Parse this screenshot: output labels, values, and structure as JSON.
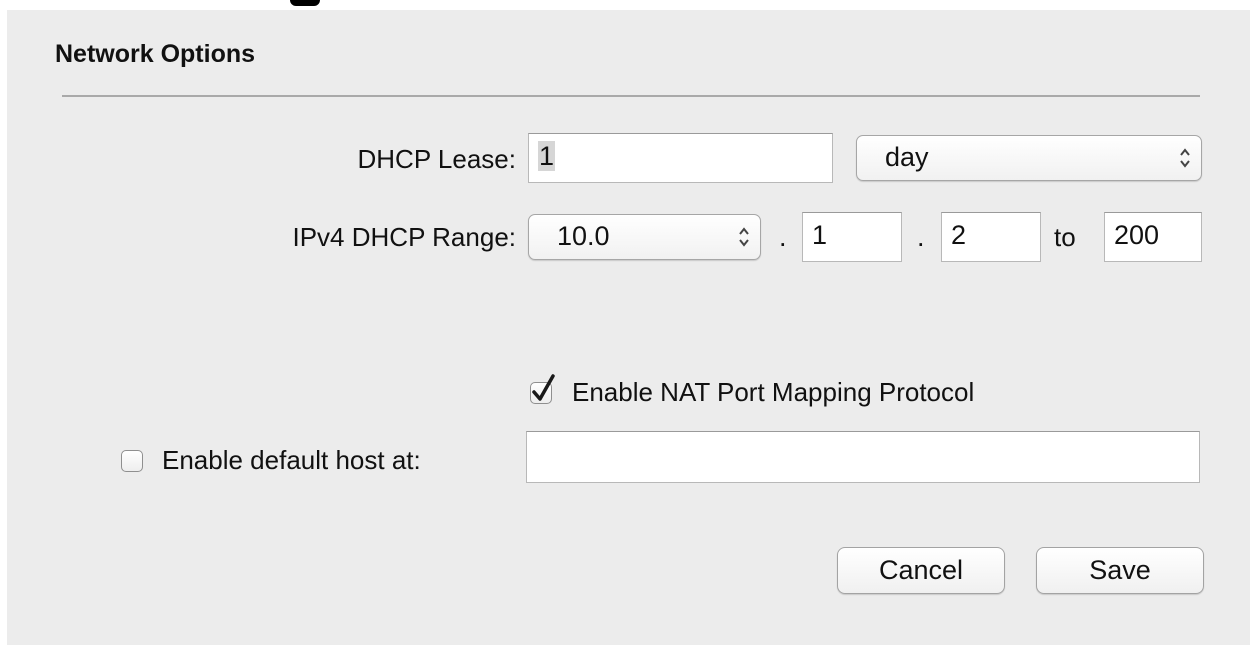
{
  "section": {
    "title": "Network Options"
  },
  "dhcp_lease": {
    "label": "DHCP Lease:",
    "value": "1",
    "unit": "day"
  },
  "dhcp_range": {
    "label": "IPv4 DHCP Range:",
    "prefix": "10.0",
    "separator1": ".",
    "octet3": "1",
    "separator2": ".",
    "start": "2",
    "to_label": "to",
    "end": "200"
  },
  "nat_pmp": {
    "label": "Enable NAT Port Mapping Protocol",
    "checked": true
  },
  "default_host": {
    "label": "Enable default host at:",
    "checked": false,
    "value": ""
  },
  "buttons": {
    "cancel": "Cancel",
    "save": "Save"
  },
  "icons": {
    "popup_arrows": "up-down-chevrons-icon",
    "checkmark": "checkmark-icon"
  }
}
